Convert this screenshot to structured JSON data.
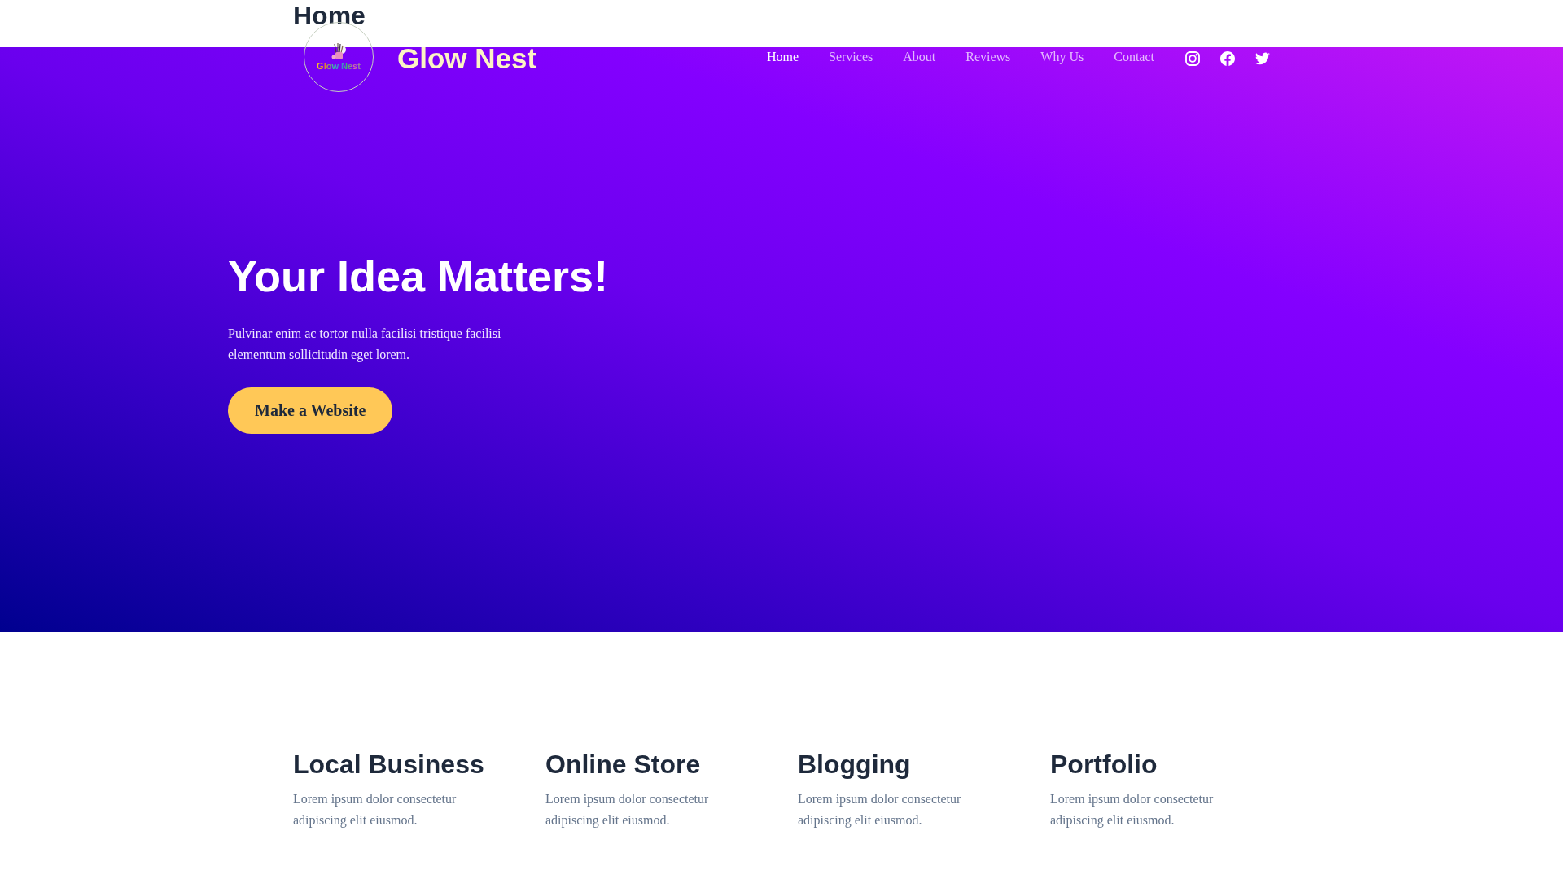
{
  "page_title": "Home",
  "header": {
    "logo": {
      "text": "Glow Nest"
    },
    "site_title": "Glow Nest",
    "nav": [
      {
        "label": "Home",
        "selected": true
      },
      {
        "label": "Services",
        "selected": false
      },
      {
        "label": "About",
        "selected": false
      },
      {
        "label": "Reviews",
        "selected": false
      },
      {
        "label": "Why Us",
        "selected": false
      },
      {
        "label": "Contact",
        "selected": false
      }
    ],
    "social": [
      {
        "kind": "instagram"
      },
      {
        "kind": "facebook"
      },
      {
        "kind": "twitter"
      }
    ]
  },
  "hero": {
    "headline": "Your Idea Matters!",
    "text": "Pulvinar enim ac tortor nulla facilisi tristique facilisi elementum sollicitudin eget lorem.",
    "button": "Make a Website"
  },
  "features": [
    {
      "title": "Local Business",
      "text": "Lorem ipsum dolor consectetur adipiscing elit eiusmod."
    },
    {
      "title": "Online Store",
      "text": "Lorem ipsum dolor consectetur adipiscing elit eiusmod."
    },
    {
      "title": "Blogging",
      "text": "Lorem ipsum dolor consectetur adipiscing elit eiusmod."
    },
    {
      "title": "Portfolio",
      "text": "Lorem ipsum dolor consectetur adipiscing elit eiusmod."
    }
  ]
}
